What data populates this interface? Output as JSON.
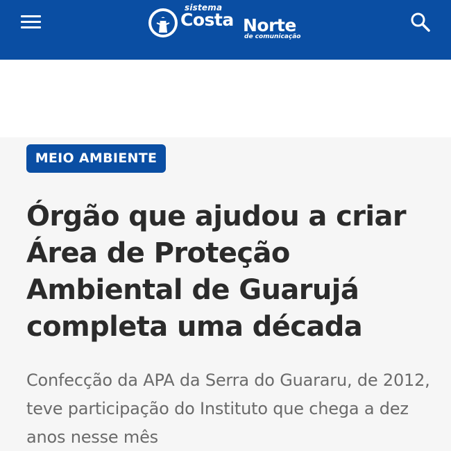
{
  "header": {
    "background": "#0a4ea3",
    "menu_icon": "hamburger-menu-icon",
    "search_icon": "search-icon",
    "logo": {
      "sistema": "sistema",
      "costa": "Costa",
      "norte": "Norte",
      "subtitle": "de comunicação"
    }
  },
  "article": {
    "category": "MEIO AMBIENTE",
    "headline": "Órgão que ajudou a criar Área de Proteção Ambiental de Guarujá completa uma década",
    "subtitle": "Confecção da APA da Serra do Guararu, de 2012, teve participação do Instituto que chega a dez anos nesse mês"
  },
  "colors": {
    "brand": "#0a4ea3",
    "headline": "#2b2b2b",
    "subtitle": "#6a6a6a",
    "background": "#f6f6f6"
  }
}
